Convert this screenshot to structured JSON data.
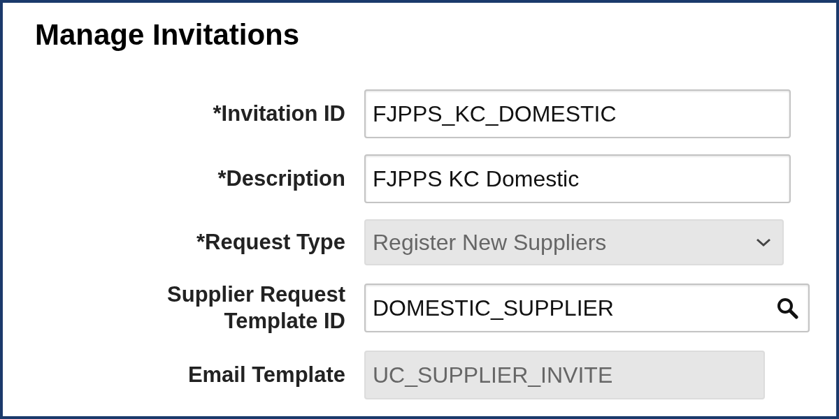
{
  "title": "Manage Invitations",
  "fields": [
    {
      "label": "*Invitation ID",
      "kind": "text",
      "value": "FJPPS_KC_DOMESTIC",
      "disabled": false
    },
    {
      "label": "*Description",
      "kind": "text",
      "value": "FJPPS KC Domestic",
      "disabled": false
    },
    {
      "label": "*Request Type",
      "kind": "select",
      "value": "Register New Suppliers",
      "disabled": true
    },
    {
      "label": "Supplier Request Template ID",
      "kind": "lookup",
      "value": "DOMESTIC_SUPPLIER",
      "disabled": false
    },
    {
      "label": "Email Template",
      "kind": "text",
      "value": "UC_SUPPLIER_INVITE",
      "disabled": true
    }
  ]
}
